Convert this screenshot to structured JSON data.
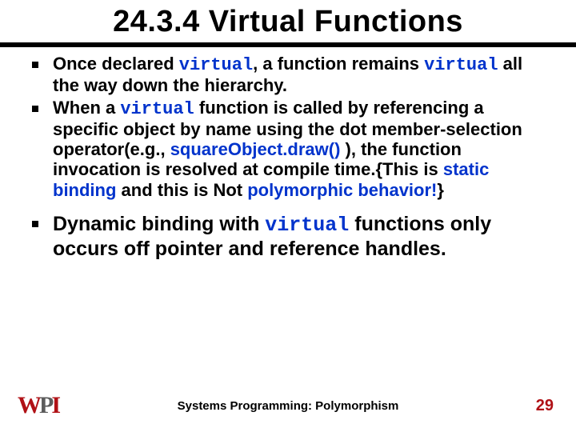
{
  "title": "24.3.4 Virtual Functions",
  "bullets": {
    "b1a": "Once declared ",
    "b1_virtual1": "virtual",
    "b1b": ", a function remains ",
    "b1_virtual2": "virtual",
    "b1c": " all the way down the hierarchy.",
    "b2a": "When a ",
    "b2_virtual": "virtual",
    "b2b": " function is called by referencing a specific object by name using the dot member-selection operator(e.g., ",
    "b2_code": "squareObject.draw()",
    "b2c": " ), the function invocation is resolved at compile time.{This is ",
    "b2_sb": "static binding",
    "b2d": " and this is Not ",
    "b2_pb": "polymorphic behavior!",
    "b2e": "}",
    "b3a": "Dynamic binding with ",
    "b3_virtual": "virtual",
    "b3b": " functions only occurs off pointer and reference handles."
  },
  "footer": {
    "center": "Systems Programming:  Polymorphism",
    "page": "29",
    "logo_w": "W",
    "logo_p": "P",
    "logo_i": "I"
  }
}
